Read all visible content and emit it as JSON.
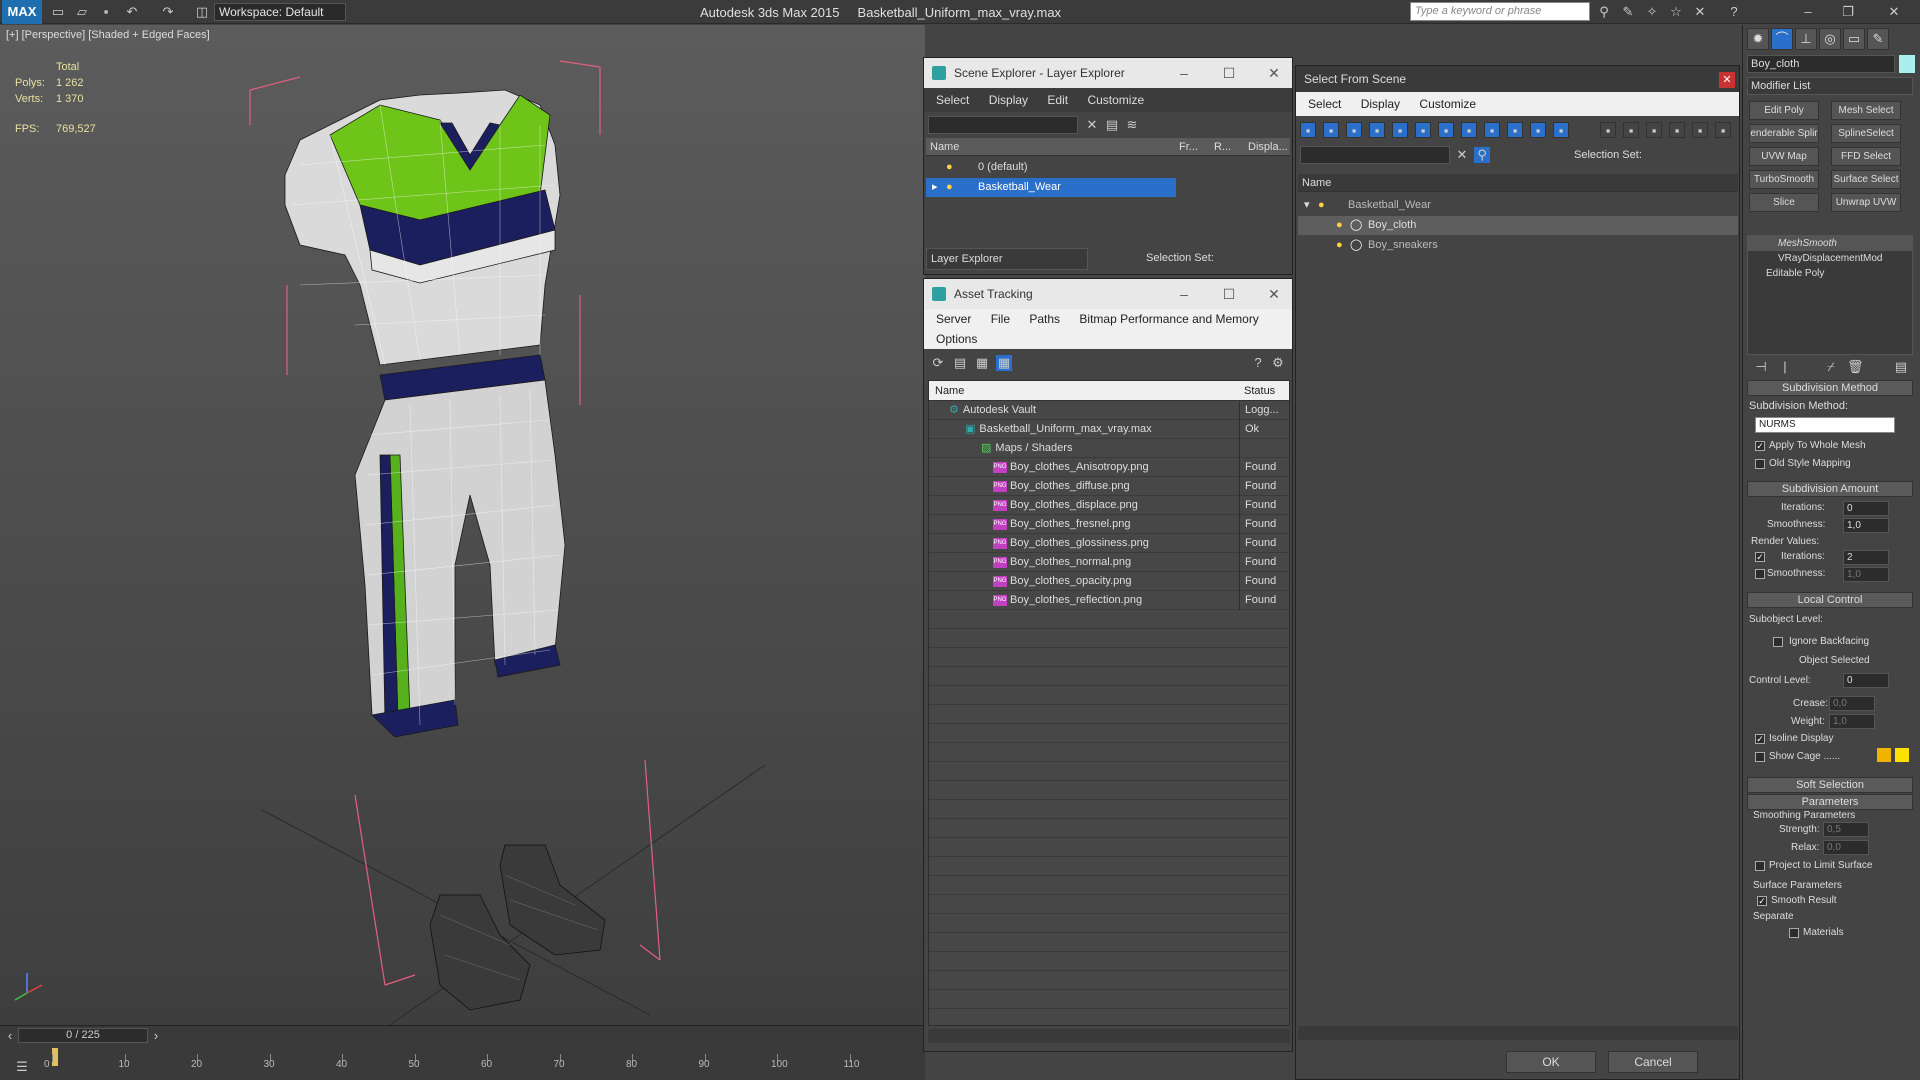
{
  "app": {
    "title": "Autodesk 3ds Max  2015",
    "file": "Basketball_Uniform_max_vray.max",
    "logo": "MAX",
    "workspace": "Workspace: Default",
    "search_placeholder": "Type a keyword or phrase"
  },
  "viewport": {
    "label": "[+] [Perspective] [Shaded + Edged Faces]",
    "stats": {
      "total": "Total",
      "polys_label": "Polys:",
      "polys": "1 262",
      "verts_label": "Verts:",
      "verts": "1 370",
      "fps_label": "FPS:",
      "fps": "769,527"
    }
  },
  "timeline": {
    "frame": "0 / 225",
    "ticks": [
      "0",
      "10",
      "20",
      "30",
      "40",
      "50",
      "60",
      "70",
      "80",
      "90",
      "100",
      "110"
    ]
  },
  "scene_explorer": {
    "title": "Scene Explorer - Layer Explorer",
    "menu": [
      "Select",
      "Display",
      "Edit",
      "Customize"
    ],
    "columns": [
      "Name",
      "Fr...",
      "R...",
      "Displa..."
    ],
    "layers": [
      "0 (default)",
      "Basketball_Wear"
    ],
    "footer_dropdown": "Layer Explorer",
    "selection_set": "Selection Set:"
  },
  "asset_tracking": {
    "title": "Asset Tracking",
    "menu": [
      "Server",
      "File",
      "Paths",
      "Bitmap Performance and Memory"
    ],
    "menu2": "Options",
    "columns": [
      "Name",
      "Status"
    ],
    "rows": [
      {
        "name": "Autodesk Vault",
        "status": "Logg..."
      },
      {
        "name": "Basketball_Uniform_max_vray.max",
        "status": "Ok"
      },
      {
        "name": "Maps / Shaders",
        "status": ""
      },
      {
        "name": "Boy_clothes_Anisotropy.png",
        "status": "Found"
      },
      {
        "name": "Boy_clothes_diffuse.png",
        "status": "Found"
      },
      {
        "name": "Boy_clothes_displace.png",
        "status": "Found"
      },
      {
        "name": "Boy_clothes_fresnel.png",
        "status": "Found"
      },
      {
        "name": "Boy_clothes_glossiness.png",
        "status": "Found"
      },
      {
        "name": "Boy_clothes_normal.png",
        "status": "Found"
      },
      {
        "name": "Boy_clothes_opacity.png",
        "status": "Found"
      },
      {
        "name": "Boy_clothes_reflection.png",
        "status": "Found"
      }
    ]
  },
  "select_from_scene": {
    "title": "Select From Scene",
    "menu": [
      "Select",
      "Display",
      "Customize"
    ],
    "selection_set": "Selection Set:",
    "column": "Name",
    "tree": [
      "Basketball_Wear",
      "Boy_cloth",
      "Boy_sneakers"
    ],
    "ok": "OK",
    "cancel": "Cancel"
  },
  "command_panel": {
    "object_name": "Boy_cloth",
    "modifier_list": "Modifier List",
    "modifier_buttons": [
      "Edit Poly",
      "Mesh Select",
      "enderable Splir",
      "SplineSelect",
      "UVW Map",
      "FFD Select",
      "TurboSmooth",
      "Surface Select",
      "Slice",
      "Unwrap UVW"
    ],
    "stack": [
      "MeshSmooth",
      "VRayDisplacementMod",
      "Editable Poly"
    ],
    "subdivision_method": {
      "header": "Subdivision Method",
      "label": "Subdivision Method:",
      "value": "NURMS",
      "apply_whole": "Apply To Whole Mesh",
      "old_style": "Old Style Mapping"
    },
    "subdivision_amount": {
      "header": "Subdivision Amount",
      "iterations_label": "Iterations:",
      "iterations": "0",
      "smoothness_label": "Smoothness:",
      "smoothness": "1,0",
      "render_values": "Render Values:",
      "r_iterations": "2",
      "r_smoothness": "1,0"
    },
    "local_control": {
      "header": "Local Control",
      "subobject": "Subobject Level:",
      "ignore_backfacing": "Ignore Backfacing",
      "object_selected": "Object Selected",
      "control_level_label": "Control Level:",
      "control_level": "0",
      "crease_label": "Crease:",
      "crease": "0,0",
      "weight_label": "Weight:",
      "weight": "1,0",
      "isoline": "Isoline Display",
      "show_cage": "Show Cage ......"
    },
    "soft_selection": "Soft Selection",
    "parameters": {
      "header": "Parameters",
      "smoothing": "Smoothing Parameters",
      "strength_label": "Strength:",
      "strength": "0,5",
      "relax_label": "Relax:",
      "relax": "0,0",
      "project": "Project to Limit Surface",
      "surface": "Surface Parameters",
      "smooth_result": "Smooth Result",
      "separate": "Separate",
      "materials": "Materials"
    },
    "colors": {
      "cage1": "#f0b400",
      "cage2": "#ffe000"
    }
  }
}
